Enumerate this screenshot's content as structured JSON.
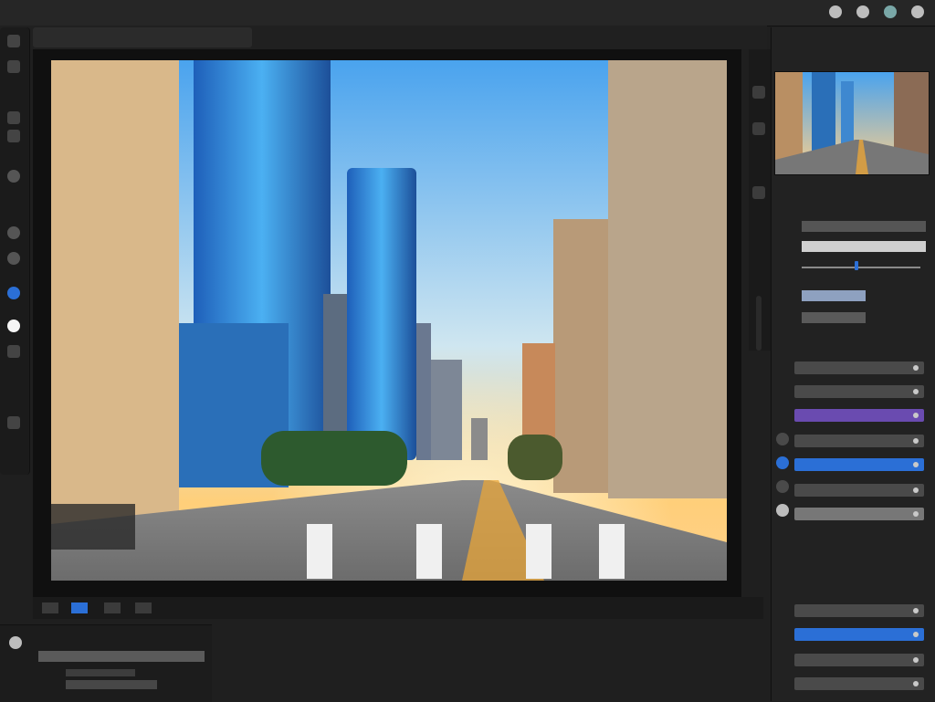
{
  "menu": {
    "title": ""
  },
  "header": {
    "tab_label": "",
    "tab_label_2": ""
  },
  "right_panel": {
    "header": "",
    "thumb_label": "",
    "section_adjust": "",
    "section_layers": "",
    "section_more": ""
  },
  "bottom_panel": {
    "title": ""
  },
  "colors": {
    "accent": "#2b6fd6",
    "panel": "#222222",
    "purple": "#6a4bb0"
  },
  "icons": [
    "image-icon",
    "home-icon",
    "settings-icon",
    "layers-icon",
    "gear-icon"
  ]
}
